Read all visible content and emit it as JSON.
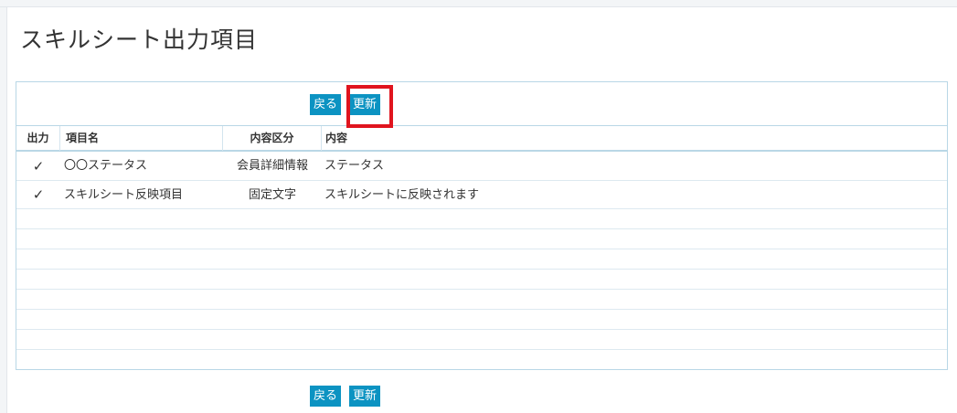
{
  "page": {
    "title": "スキルシート出力項目"
  },
  "buttons": {
    "back_label": "戻る",
    "update_label": "更新"
  },
  "table": {
    "headers": {
      "output": "出力",
      "item_name": "項目名",
      "category": "内容区分",
      "content": "内容"
    },
    "rows": [
      {
        "output": "✓",
        "item_name": "〇〇ステータス",
        "category": "会員詳細情報",
        "content": "ステータス"
      },
      {
        "output": "✓",
        "item_name": "スキルシート反映項目",
        "category": "固定文字",
        "content": "スキルシートに反映されます"
      }
    ]
  },
  "colors": {
    "accent": "#0c93c2",
    "highlight": "#e0141e",
    "border": "#b9d7e6"
  }
}
